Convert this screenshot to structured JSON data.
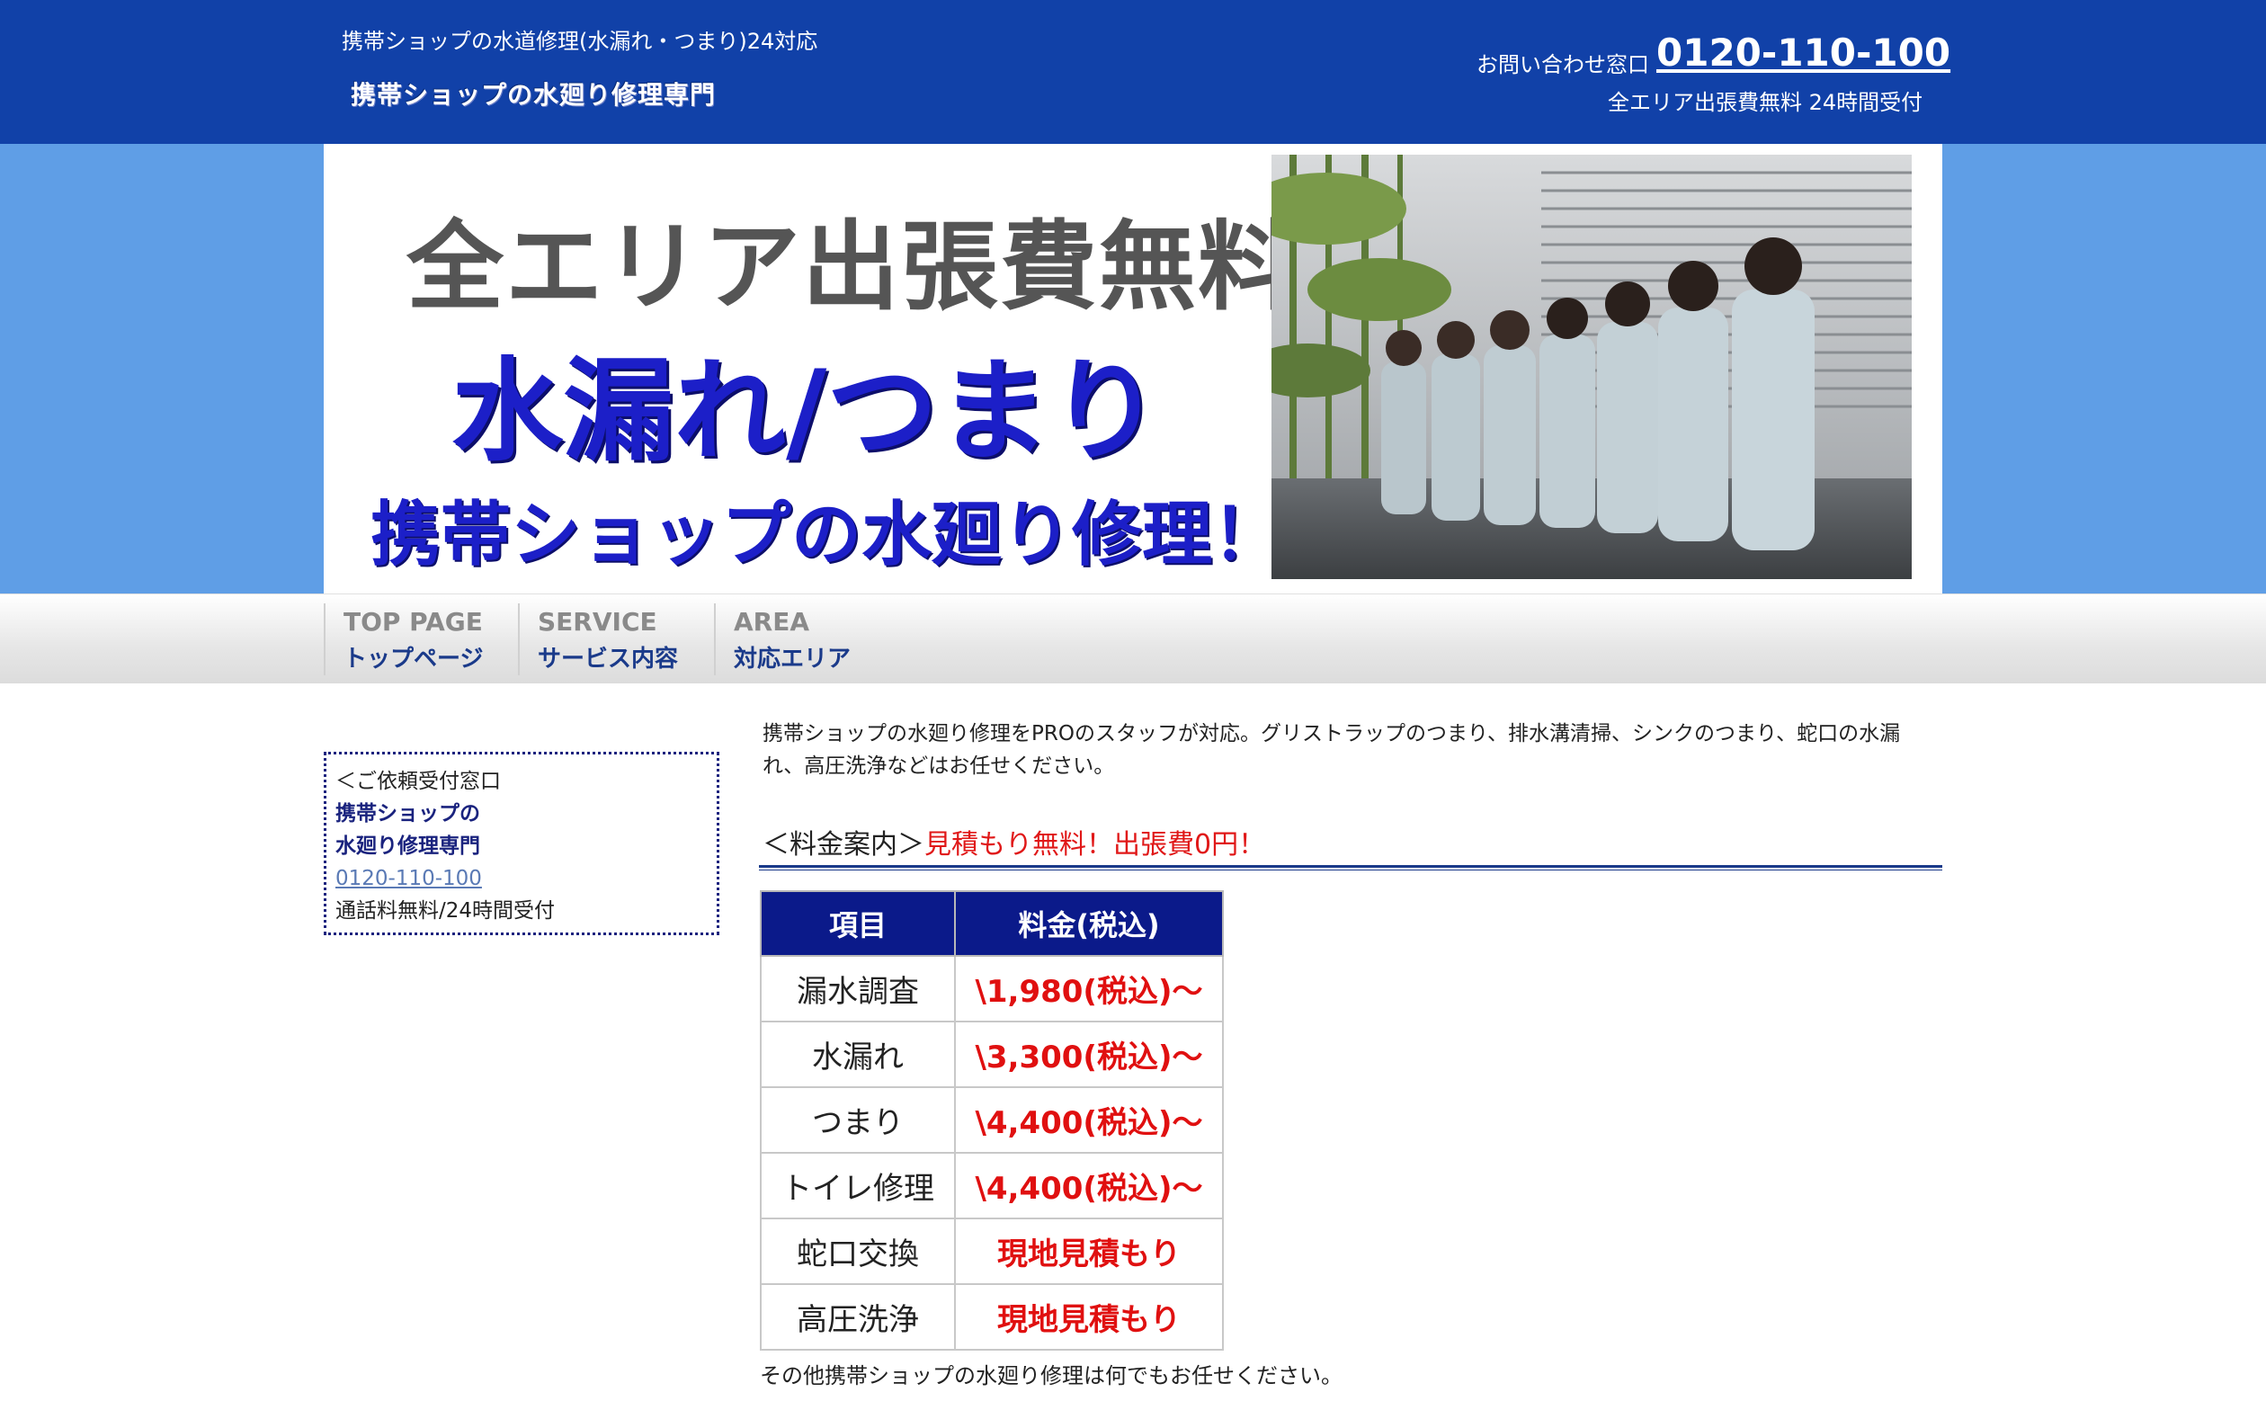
{
  "header": {
    "tagline": "携帯ショップの水道修理(水漏れ・つまり)24対応",
    "logo": "携帯ショップの水廻り修理専門",
    "contact_label": "お問い合わせ窓口",
    "contact_phone": "0120-110-100",
    "contact_sub": "全エリア出張費無料 24時間受付"
  },
  "hero": {
    "line1": "全エリア出張費無料",
    "line2": "水漏れ/つまり",
    "line3": "携帯ショップの水廻り修理！"
  },
  "nav": {
    "items": [
      {
        "en": "TOP PAGE",
        "ja": "トップページ"
      },
      {
        "en": "SERVICE",
        "ja": "サービス内容"
      },
      {
        "en": "AREA",
        "ja": "対応エリア"
      }
    ]
  },
  "sidebar": {
    "heading": "＜ご依頼受付窓口",
    "name_line1": "携帯ショップの",
    "name_line2": "水廻り修理専門",
    "phone": "0120-110-100",
    "note": "通話料無料/24時間受付"
  },
  "main": {
    "intro": "携帯ショップの水廻り修理をPROのスタッフが対応。グリストラップのつまり、排水溝清掃、シンクのつまり、蛇口の水漏れ、高圧洗浄などはお任せください。",
    "price_heading_prefix": "＜料金案内＞",
    "price_heading_highlight": "見積もり無料！出張費0円！",
    "table": {
      "headers": [
        "項目",
        "料金(税込)"
      ],
      "rows": [
        [
          "漏水調査",
          "\\1,980(税込)〜"
        ],
        [
          "水漏れ",
          "\\3,300(税込)〜"
        ],
        [
          "つまり",
          "\\4,400(税込)〜"
        ],
        [
          "トイレ修理",
          "\\4,400(税込)〜"
        ],
        [
          "蛇口交換",
          "現地見積もり"
        ],
        [
          "高圧洗浄",
          "現地見積もり"
        ]
      ]
    },
    "closing": "その他携帯ショップの水廻り修理は何でもお任せください。"
  },
  "colors": {
    "header_bg": "#1141a8",
    "hero_band": "#5f9ee6",
    "accent_red": "#e01818",
    "table_header": "#0b1a8a"
  }
}
